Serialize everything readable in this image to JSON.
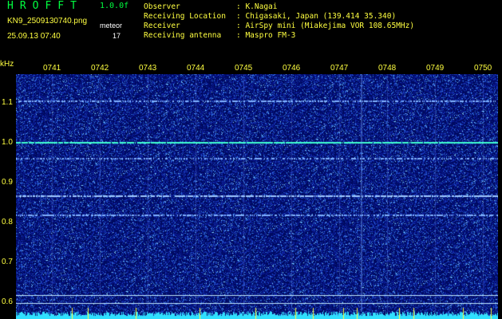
{
  "app": {
    "title": "HROFFT",
    "version": "1.0.0f"
  },
  "file": {
    "name": "KN9_2509130740.png",
    "datetime": "25.09.13 07:40"
  },
  "meteor": {
    "label": "meteor",
    "count": "17"
  },
  "info": [
    {
      "key": "Observer",
      "value": ": K.Nagai"
    },
    {
      "key": "Receiving Location",
      "value": ": Chigasaki, Japan (139.414 35.340)"
    },
    {
      "key": "Receiver",
      "value": ": AirSpy mini (Miakejima VOR 108.65MHz)"
    },
    {
      "key": "Receiving antenna",
      "value": ": Maspro FM-3"
    }
  ],
  "axis": {
    "unit": "kHz",
    "times": [
      "0741",
      "0742",
      "0743",
      "0744",
      "0745",
      "0746",
      "0747",
      "0748",
      "0749",
      "0750"
    ],
    "freqs": [
      "1.1",
      "1.0",
      "0.9",
      "0.8",
      "0.7",
      "0.6"
    ]
  },
  "colors": {
    "background": "#000a60",
    "header_text": "#ffff40",
    "title": "#00ff40",
    "carrier": "#40d0ff"
  }
}
